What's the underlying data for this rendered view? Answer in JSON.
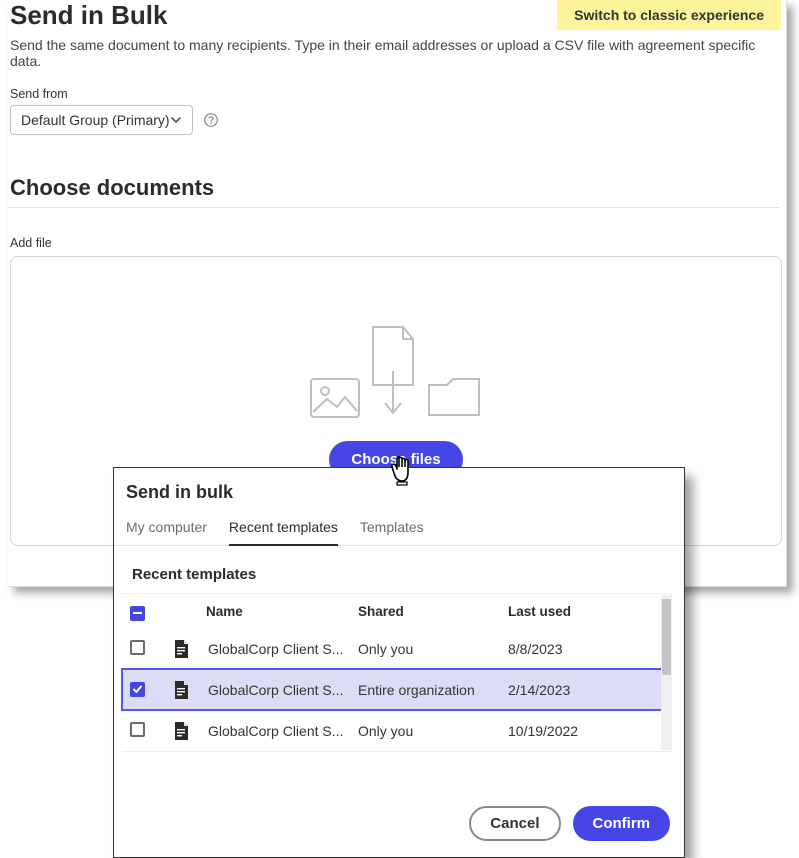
{
  "banner": {
    "switch_label": "Switch to classic experience"
  },
  "page": {
    "title": "Send in Bulk",
    "subtitle": "Send the same document to many recipients. Type in their email addresses or upload a CSV file with agreement specific data."
  },
  "send_from": {
    "label": "Send from",
    "value": "Default Group (Primary)"
  },
  "choose_documents": {
    "heading": "Choose documents",
    "add_file_label": "Add file",
    "choose_files_label": "Choose files"
  },
  "dialog": {
    "title": "Send in bulk",
    "tabs": [
      "My computer",
      "Recent templates",
      "Templates"
    ],
    "active_tab": 1,
    "list_title": "Recent templates",
    "columns": {
      "name": "Name",
      "shared": "Shared",
      "last_used": "Last used"
    },
    "rows": [
      {
        "selected": false,
        "name": "GlobalCorp Client S...",
        "shared": "Only you",
        "last_used": "8/8/2023"
      },
      {
        "selected": true,
        "name": "GlobalCorp Client S...",
        "shared": "Entire organization",
        "last_used": "2/14/2023"
      },
      {
        "selected": false,
        "name": "GlobalCorp Client S...",
        "shared": "Only you",
        "last_used": "10/19/2022"
      }
    ],
    "cancel_label": "Cancel",
    "confirm_label": "Confirm"
  }
}
